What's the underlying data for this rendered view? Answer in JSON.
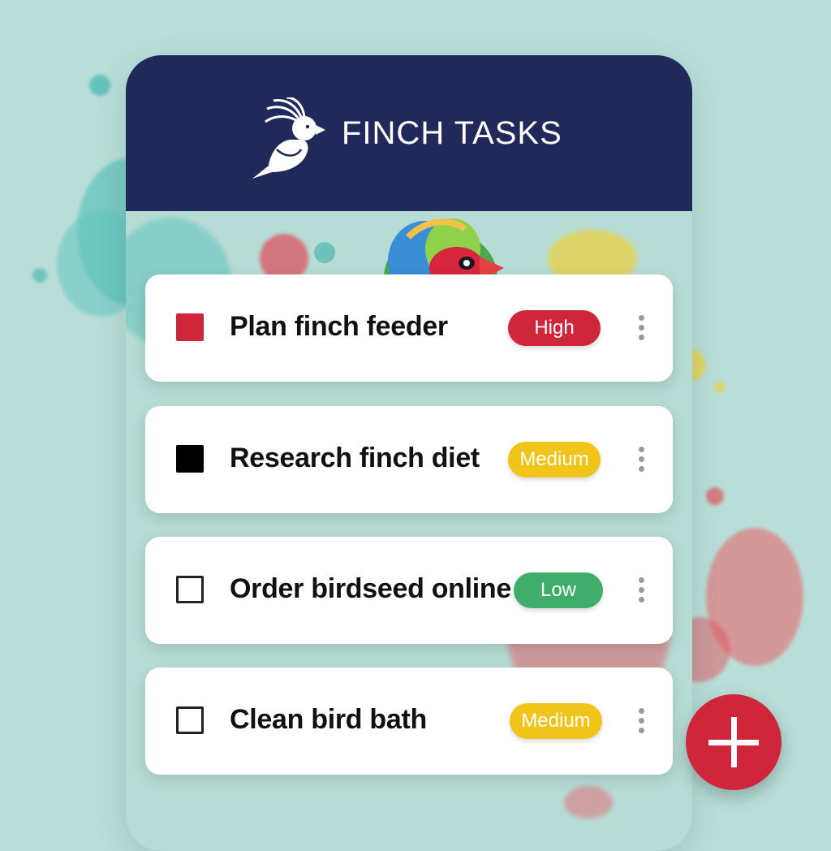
{
  "app": {
    "title": "FINCH TASKS",
    "logo": "cockatiel-logo-icon"
  },
  "tasks": [
    {
      "title": "Plan finch feeder",
      "priority": "High",
      "priority_color": "#d0263c",
      "checkbox": "red-filled",
      "checkbox_color": "#d0263c"
    },
    {
      "title": "Research finch diet",
      "priority": "Medium",
      "priority_color": "#f0c419",
      "checkbox": "black-filled",
      "checkbox_color": "#000000"
    },
    {
      "title": "Order birdseed online",
      "priority": "Low",
      "priority_color": "#3fae6a",
      "checkbox": "empty"
    },
    {
      "title": "Clean bird bath",
      "priority": "Medium",
      "priority_color": "#f0c419",
      "checkbox": "empty"
    }
  ],
  "fab": {
    "icon": "plus-icon",
    "color": "#d0263c"
  },
  "colors": {
    "header": "#21285a",
    "background": "#b9ded8"
  }
}
